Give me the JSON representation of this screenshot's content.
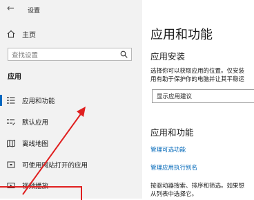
{
  "window": {
    "title": "设置"
  },
  "nav": {
    "home_label": "主页",
    "search_placeholder": "查找设置",
    "section_label": "应用",
    "items": [
      {
        "label": "应用和功能",
        "icon": "apps-features-icon",
        "selected": true
      },
      {
        "label": "默认应用",
        "icon": "default-apps-icon"
      },
      {
        "label": "离线地图",
        "icon": "offline-maps-icon"
      },
      {
        "label": "可使用网站打开的应用",
        "icon": "apps-for-websites-icon"
      },
      {
        "label": "视频播放",
        "icon": "video-playback-icon"
      }
    ]
  },
  "main": {
    "title": "应用和功能",
    "install_heading": "应用安装",
    "install_desc_line1": "选择你可以获取应用的位置。仅安装",
    "install_desc_line2": "用有助于保护你的电脑并让其平稳运",
    "install_dropdown_value": "显示应用建议",
    "apps_heading": "应用和功能",
    "link_optional_features": "管理可选功能",
    "link_app_aliases": "管理应用执行别名",
    "apps_desc_line1": "按驱动器搜索、排序和筛选。如果想",
    "apps_desc_line2": "从列表中选择它。"
  },
  "colors": {
    "accent": "#0067c0",
    "link": "#0067b8",
    "sidebar_bg": "#f2f2f2",
    "annotation": "#e02020"
  }
}
